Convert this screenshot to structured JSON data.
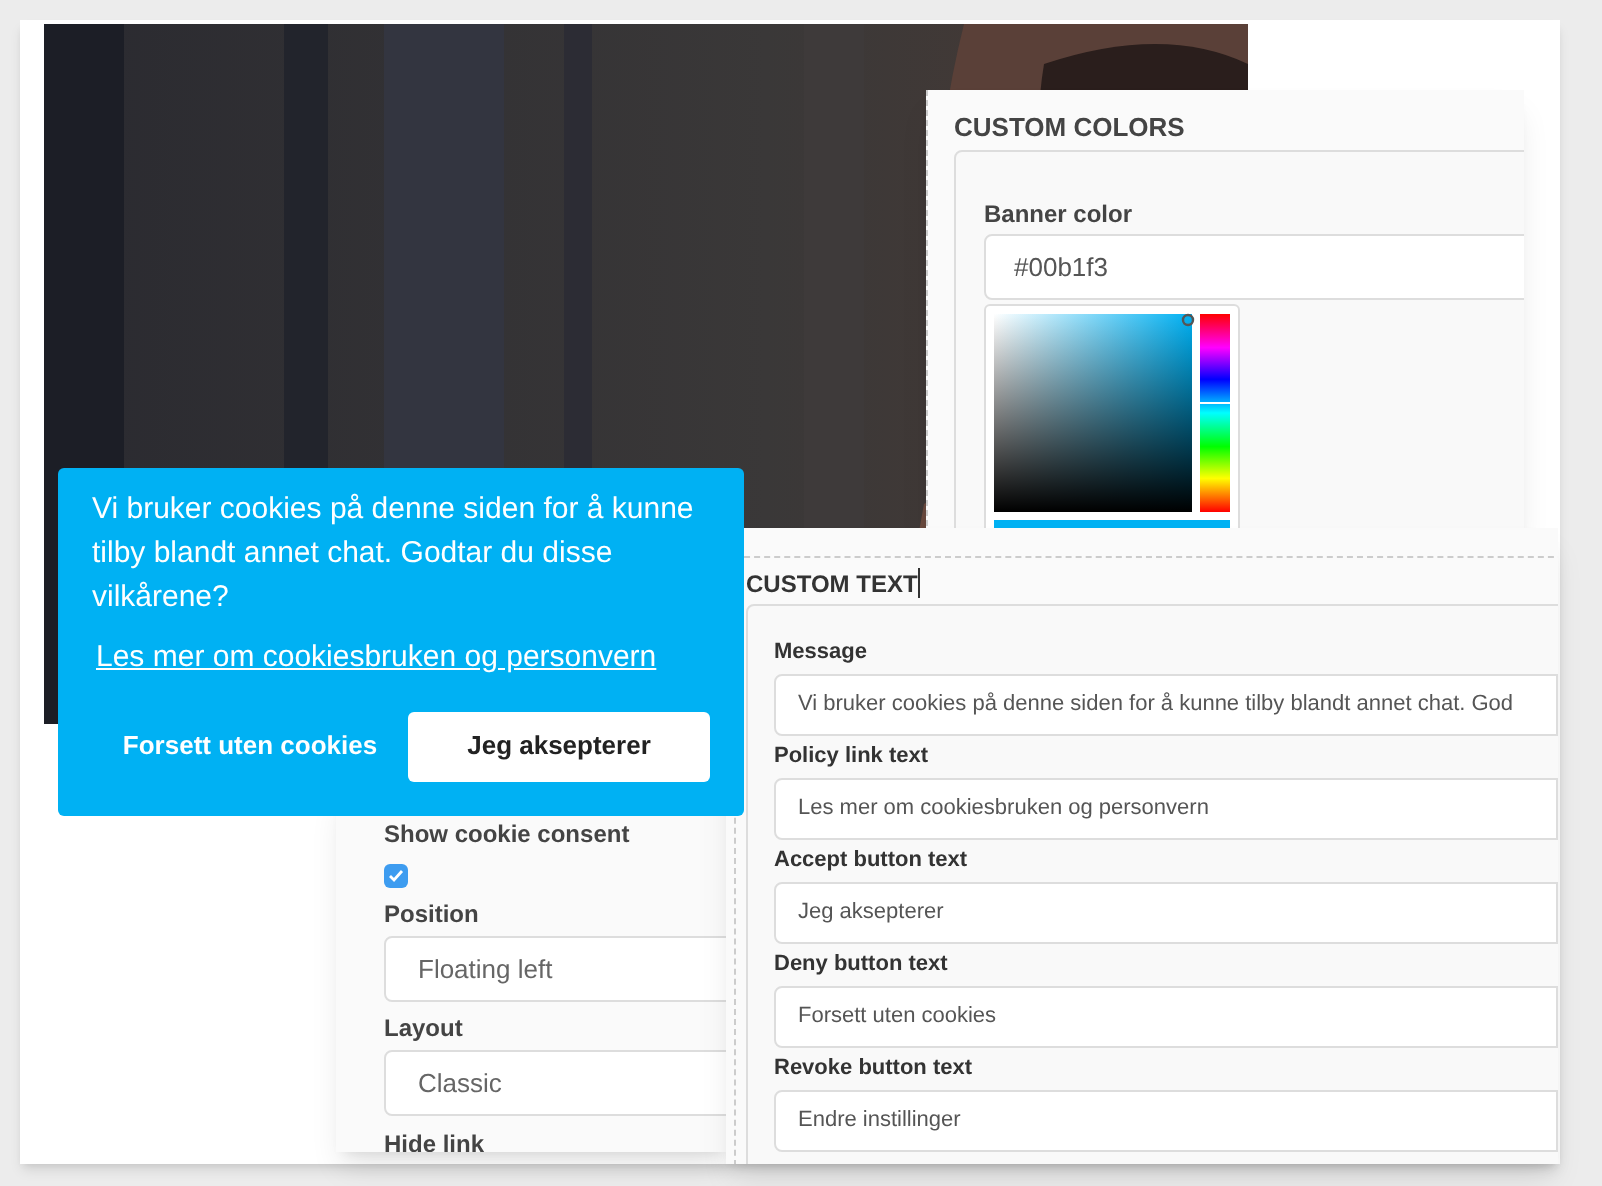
{
  "custom_colors": {
    "title": "CUSTOM COLORS",
    "field": {
      "label": "Banner color",
      "value": "#00b1f3"
    }
  },
  "cookie_banner": {
    "message": "Vi bruker cookies på denne siden for å kunne tilby blandt annet chat. Godtar du disse vilkårene?",
    "policy_link": "Les mer om cookiesbruken og personvern",
    "deny_button": "Forsett uten cookies",
    "accept_button": "Jeg aksepterer"
  },
  "settings": {
    "show_consent": {
      "label": "Show cookie consent",
      "checked": true
    },
    "fields": [
      {
        "label": "Position",
        "value": "Floating left"
      },
      {
        "label": "Layout",
        "value": "Classic"
      }
    ],
    "next_label": "Hide link"
  },
  "custom_text": {
    "title": "CUSTOM TEXT",
    "fields": [
      {
        "label": "Message",
        "value": "Vi bruker cookies på denne siden for å kunne tilby blandt annet chat. God"
      },
      {
        "label": "Policy link text",
        "value": "Les mer om cookiesbruken og personvern"
      },
      {
        "label": "Accept button text",
        "value": "Jeg aksepterer"
      },
      {
        "label": "Deny button text",
        "value": "Forsett uten cookies"
      },
      {
        "label": "Revoke button text",
        "value": "Endre instillinger"
      }
    ]
  }
}
